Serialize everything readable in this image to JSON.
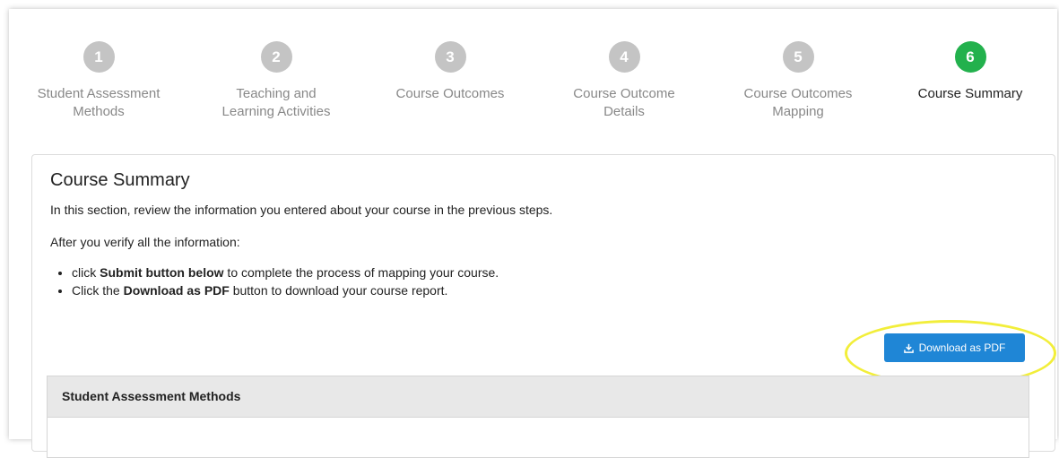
{
  "stepper": {
    "steps": [
      {
        "number": "1",
        "label_line1": "Student Assessment",
        "label_line2": "Methods",
        "state": "complete"
      },
      {
        "number": "2",
        "label_line1": "Teaching and",
        "label_line2": "Learning Activities",
        "state": "complete"
      },
      {
        "number": "3",
        "label_line1": "Course Outcomes",
        "label_line2": "",
        "state": "complete"
      },
      {
        "number": "4",
        "label_line1": "Course Outcome",
        "label_line2": "Details",
        "state": "complete"
      },
      {
        "number": "5",
        "label_line1": "Course Outcomes",
        "label_line2": "Mapping",
        "state": "complete"
      },
      {
        "number": "6",
        "label_line1": "Course Summary",
        "label_line2": "",
        "state": "active"
      }
    ],
    "colors": {
      "inactive": "#c4c4c4",
      "active": "#23b14d"
    }
  },
  "summary": {
    "title": "Course Summary",
    "intro": "In this section, review the information you entered about your course in the previous steps.",
    "verify_text": "After you verify all the information:",
    "bullets": [
      {
        "prefix": "click ",
        "bold": "Submit button below",
        "suffix": " to complete the process of mapping your course."
      },
      {
        "prefix": "Click the ",
        "bold": "Download as PDF",
        "suffix": " button to download your course report."
      }
    ],
    "download_button": {
      "label": "Download as PDF",
      "icon": "download-icon",
      "color": "#1f86d6"
    },
    "highlight_color": "#f2ee3a"
  },
  "sections": [
    {
      "title": "Student Assessment Methods"
    }
  ]
}
